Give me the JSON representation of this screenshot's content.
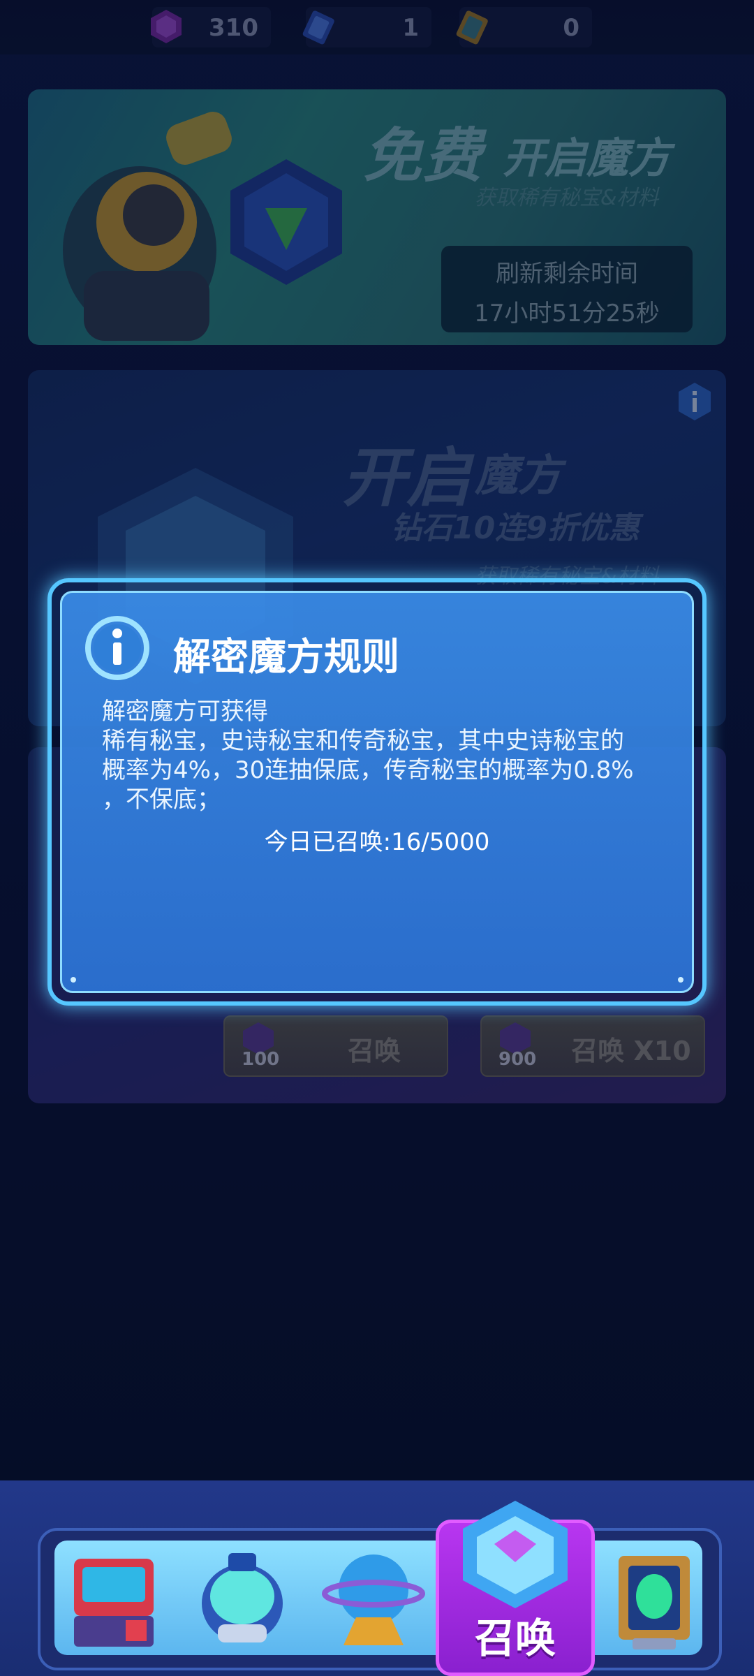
{
  "currency": {
    "gems": "310",
    "ticket_blue": "1",
    "ticket_gold": "0"
  },
  "free_banner": {
    "title_big": "免费",
    "title_small": "开启魔方",
    "subtitle": "获取稀有秘宝&材料",
    "timer_label": "刷新剩余时间",
    "timer_value": "17小时51分25秒"
  },
  "cube_banner": {
    "title_big": "开启",
    "title_small": "魔方",
    "promo": "钻石10连9折优惠",
    "subtitle": "获取稀有秘宝&材料"
  },
  "summon_buttons": [
    {
      "label": "召唤",
      "cost": "100"
    },
    {
      "label": "召唤 X10",
      "cost": "900"
    }
  ],
  "dialog": {
    "title": "解密魔方规则",
    "lines": [
      "解密魔方可获得",
      "稀有秘宝，史诗秘宝和传奇秘宝，其中史诗秘宝的",
      "概率为4%，30连抽保底，传奇秘宝的概率为0.8%",
      "，不保底；"
    ],
    "today_count": "今日已召唤:16/5000"
  },
  "nav": {
    "active_label": "召唤"
  },
  "colors": {
    "dialog_border": "#56c7ff",
    "dialog_fill": "#3a8ce8",
    "nav_active": "#b836f0"
  }
}
